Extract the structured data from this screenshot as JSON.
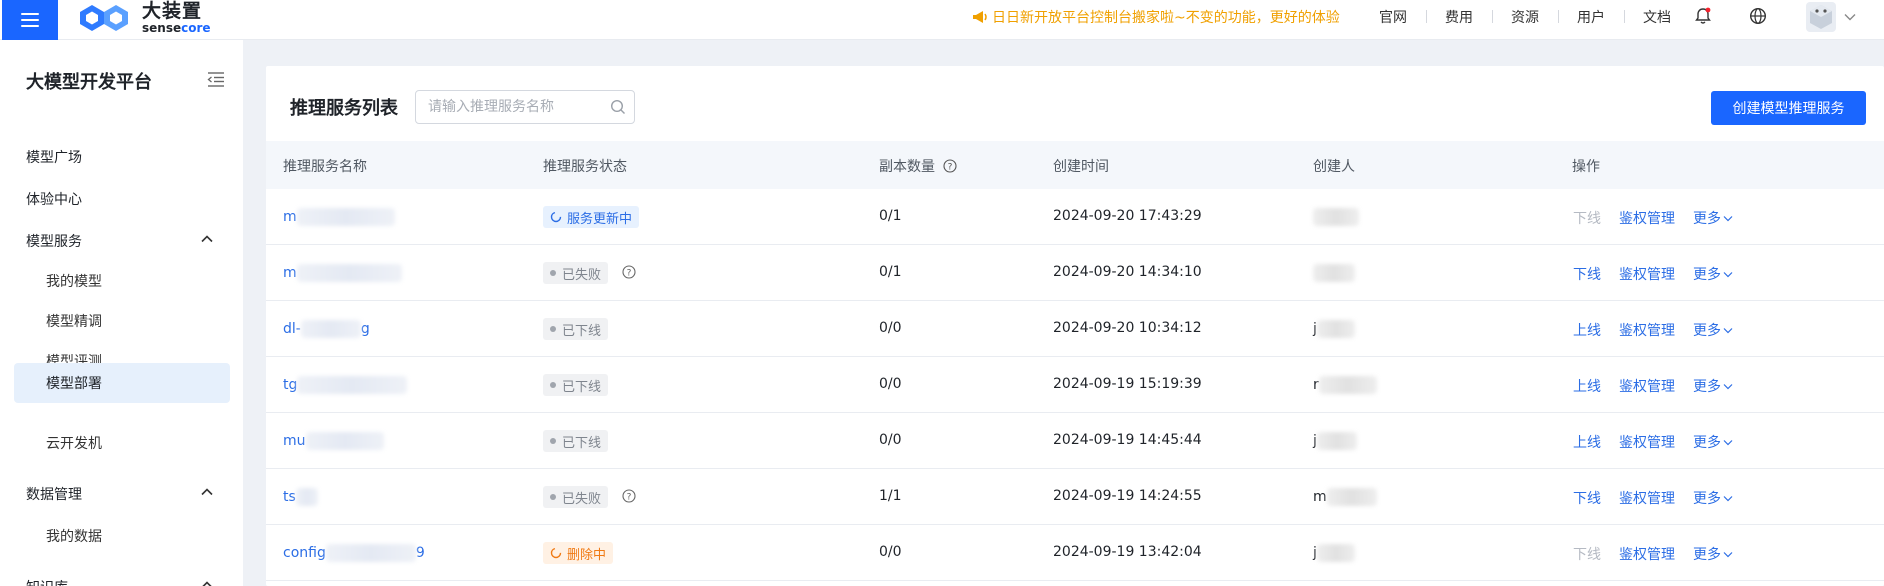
{
  "header": {
    "logo_cn": "大装置",
    "logo_en_a": "sense",
    "logo_en_b": "core",
    "announcement": "日日新开放平台控制台搬家啦~不变的功能，更好的体验",
    "links": [
      "官网",
      "费用",
      "资源",
      "用户",
      "文档"
    ],
    "icons": [
      "bell-icon",
      "globe-icon",
      "avatar",
      "chevron-down-icon"
    ],
    "accent": "#1a66ff",
    "announce_color": "#f0a000"
  },
  "sidebar": {
    "title": "大模型开发平台",
    "items": [
      {
        "label": "模型广场",
        "level": 1
      },
      {
        "label": "体验中心",
        "level": 1
      },
      {
        "label": "模型服务",
        "level": 1,
        "expandable": true
      },
      {
        "label": "我的模型",
        "level": 2
      },
      {
        "label": "模型精调",
        "level": 2
      },
      {
        "label": "模型评测",
        "level": 2
      },
      {
        "label": "模型部署",
        "level": 2,
        "active": true
      },
      {
        "label": "云开发机",
        "level": 2
      },
      {
        "label": "数据管理",
        "level": 1,
        "expandable": true
      },
      {
        "label": "我的数据",
        "level": 2
      },
      {
        "label": "知识库",
        "level": 1,
        "expandable": true
      }
    ]
  },
  "main": {
    "title": "推理服务列表",
    "search_placeholder": "请输入推理服务名称",
    "create_button": "创建模型推理服务",
    "columns": [
      "推理服务名称",
      "推理服务状态",
      "副本数量",
      "创建时间",
      "创建人",
      "操作"
    ],
    "rows": [
      {
        "name": "m",
        "status": "服务更新中",
        "status_kind": "updating",
        "replicas": "0/1",
        "created": "2024-09-20 17:43:29",
        "creator": "",
        "toggle": "下线",
        "toggle_enabled": false
      },
      {
        "name": "m",
        "status": "已失败",
        "status_kind": "failed",
        "replicas": "0/1",
        "created": "2024-09-20 14:34:10",
        "creator": "",
        "toggle": "下线",
        "toggle_enabled": true
      },
      {
        "name": "dl-",
        "name_tail": "g",
        "status": "已下线",
        "status_kind": "offline",
        "replicas": "0/0",
        "created": "2024-09-20 10:34:12",
        "creator": "j",
        "toggle": "上线",
        "toggle_enabled": true
      },
      {
        "name": "tg",
        "status": "已下线",
        "status_kind": "offline",
        "replicas": "0/0",
        "created": "2024-09-19 15:19:39",
        "creator": "r",
        "toggle": "上线",
        "toggle_enabled": true
      },
      {
        "name": "mu",
        "status": "已下线",
        "status_kind": "offline",
        "replicas": "0/0",
        "created": "2024-09-19 14:45:44",
        "creator": "j",
        "toggle": "上线",
        "toggle_enabled": true
      },
      {
        "name": "ts",
        "status": "已失败",
        "status_kind": "failed",
        "replicas": "1/1",
        "created": "2024-09-19 14:24:55",
        "creator": "m",
        "toggle": "下线",
        "toggle_enabled": true
      },
      {
        "name": "config",
        "name_tail": "9",
        "status": "删除中",
        "status_kind": "deleting",
        "replicas": "0/0",
        "created": "2024-09-19 13:42:04",
        "creator": "j",
        "toggle": "下线",
        "toggle_enabled": false
      }
    ],
    "op_auth": "鉴权管理",
    "op_more": "更多"
  }
}
